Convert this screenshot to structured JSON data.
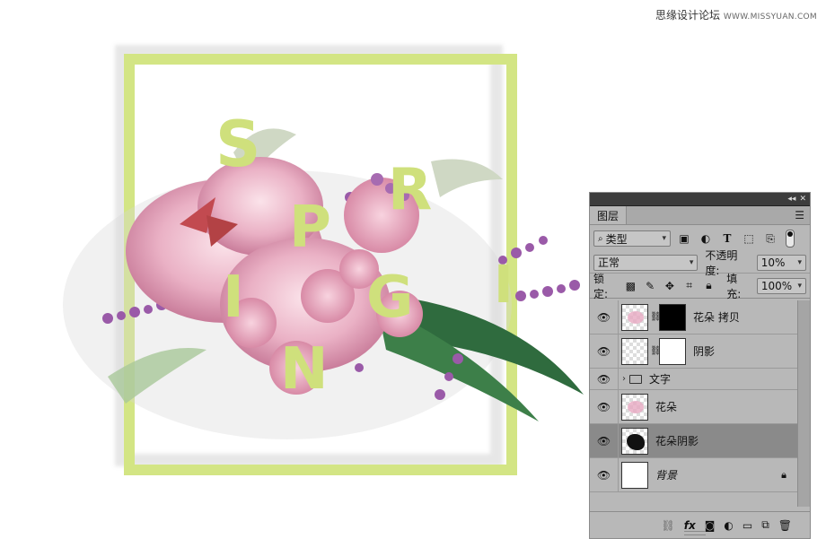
{
  "watermark": {
    "text": "思缘设计论坛",
    "site": "WWW.MISSYUAN.COM"
  },
  "artwork": {
    "letters": [
      "S",
      "R",
      "P",
      "I",
      "G",
      "I",
      "N"
    ],
    "frame_color": "#d3e584",
    "letter_color": "#cfe07c"
  },
  "panel": {
    "tab_label": "图层",
    "menu_icon": "hamburger-icon",
    "filter": {
      "search_icon": "search-icon",
      "value": "类型",
      "icons": [
        "image-filter-icon",
        "adjustment-filter-icon",
        "type-filter-icon",
        "shape-filter-icon",
        "smart-object-filter-icon"
      ]
    },
    "blend_mode": "正常",
    "opacity_label": "不透明度:",
    "opacity_value": "10%",
    "lock_label": "锁定:",
    "fill_label": "填充:",
    "fill_value": "100%",
    "layers": [
      {
        "name": "花朵 拷贝",
        "type": "masked",
        "selected": false
      },
      {
        "name": "阴影",
        "type": "masked",
        "selected": false
      },
      {
        "name": "文字",
        "type": "group",
        "selected": false
      },
      {
        "name": "花朵",
        "type": "pixel",
        "selected": false
      },
      {
        "name": "花朵阴影",
        "type": "pixel",
        "selected": true
      },
      {
        "name": "背景",
        "type": "background",
        "selected": false
      }
    ],
    "footer_icons": [
      "link-icon",
      "fx-icon",
      "add-mask-icon",
      "adjustment-layer-icon",
      "new-group-icon",
      "new-layer-icon",
      "trash-icon"
    ]
  }
}
